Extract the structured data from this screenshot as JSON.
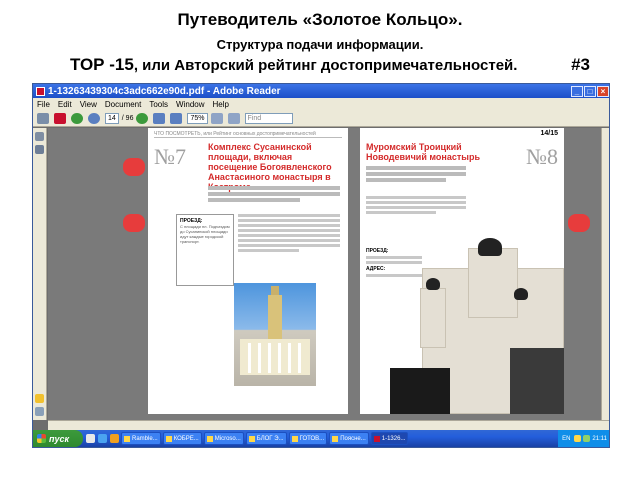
{
  "slide": {
    "title": "Путеводитель «Золотое Кольцо».",
    "subtitle": "Структура подачи информации.",
    "heading_top": "ТОР -15",
    "heading_rest": ", или Авторский рейтинг достопримечательностей.",
    "slide_number": "#3"
  },
  "window": {
    "title": "1-13263439304c3adc662e90d.pdf - Adobe Reader",
    "min": "_",
    "max": "□",
    "close": "×"
  },
  "menu": [
    "File",
    "Edit",
    "View",
    "Document",
    "Tools",
    "Window",
    "Help"
  ],
  "toolbar": {
    "page_current": "14",
    "page_total": "/ 96",
    "zoom": "75%",
    "find_placeholder": "Find"
  },
  "left_page": {
    "header": "ЧТО ПОСМОТРЕТЬ, или Рейтинг основных достопримечательностей",
    "number": "№7",
    "heading": "Комплекс Сусанинской площади, включая посещение Богоявленского Анастасиного монастыря в Костроме",
    "side_title": "ПРОЕЗД:",
    "side_text": "С площади пл. Подъездом до Сусанинской площади идут каждые городской транспорт."
  },
  "right_page": {
    "page_number": "14/15",
    "number": "№8",
    "heading": "Муромский Троицкий Новодевичий монастырь",
    "side_title": "ПРОЕЗД:",
    "side_sub": "АДРЕС:"
  },
  "taskbar": {
    "start": "пуск",
    "tasks": [
      "Ramble...",
      "КОБРЕ...",
      "Microso...",
      "БЛОГ Э...",
      "ГОТОВ...",
      "Поясне...",
      "1-1326..."
    ],
    "lang": "EN",
    "time": "21:11"
  }
}
